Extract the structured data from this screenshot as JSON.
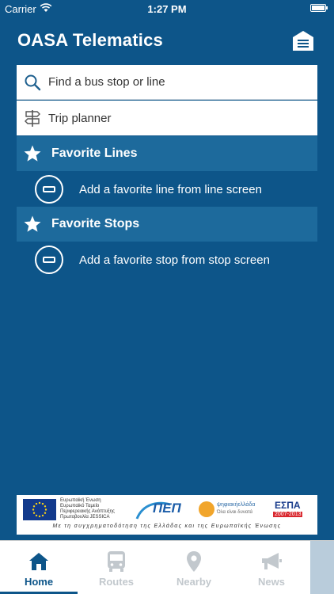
{
  "status_bar": {
    "carrier": "Carrier",
    "time": "1:27 PM"
  },
  "header": {
    "title": "OASA Telematics",
    "menu_icon": "menu-icon"
  },
  "search": {
    "label": "Find a bus stop or line",
    "icon": "search-icon"
  },
  "trip": {
    "label": "Trip planner",
    "icon": "signpost-icon"
  },
  "favorite_lines": {
    "title": "Favorite Lines",
    "hint": "Add a favorite line from line screen"
  },
  "favorite_stops": {
    "title": "Favorite Stops",
    "hint": "Add a favorite stop from stop screen"
  },
  "banner": {
    "eu_text": "Ευρωπαϊκή Ένωση Ευρωπαϊκό Ταμείο Περιφερειακής Ανάπτυξης Πρωτοβουλία JESSICA",
    "pep": "ΠΕΠ",
    "digital": "ψηφιακήελλάδα",
    "digital_sub": "Όλα είναι δυνατά",
    "espa": "ΕΣΠΑ",
    "espa_years": "2007-2013",
    "bottom": "Με τη συγχρηματοδότηση της Ελλάδας και της Ευρωπαϊκής Ένωσης"
  },
  "tabs": [
    {
      "label": "Home",
      "icon": "home-icon",
      "active": true
    },
    {
      "label": "Routes",
      "icon": "bus-icon",
      "active": false
    },
    {
      "label": "Nearby",
      "icon": "location-pin-icon",
      "active": false
    },
    {
      "label": "News",
      "icon": "megaphone-icon",
      "active": false
    }
  ],
  "colors": {
    "background": "#0d5589",
    "section_header": "#1d6a9c",
    "active_tab": "#0d5589",
    "inactive_tab": "#c2c8cd"
  }
}
